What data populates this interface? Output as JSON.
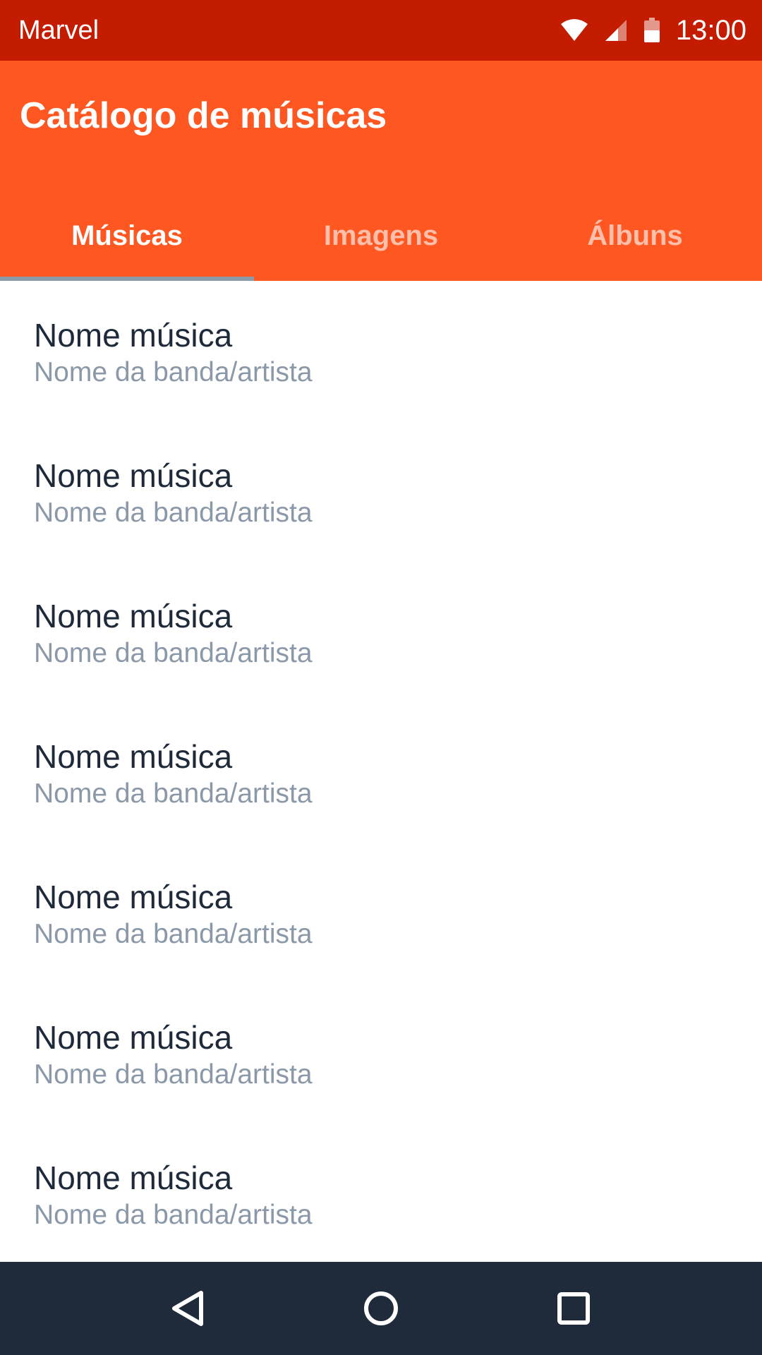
{
  "status_bar": {
    "carrier": "Marvel",
    "time": "13:00",
    "icons": [
      "wifi-icon",
      "signal-icon",
      "battery-icon"
    ]
  },
  "app_bar": {
    "title": "Catálogo de músicas",
    "background_color": "#ff5722"
  },
  "tabs": [
    {
      "label": "Músicas",
      "active": true
    },
    {
      "label": "Imagens",
      "active": false
    },
    {
      "label": "Álbuns",
      "active": false
    }
  ],
  "songs": [
    {
      "title": "Nome música",
      "artist": "Nome da banda/artista"
    },
    {
      "title": "Nome música",
      "artist": "Nome da banda/artista"
    },
    {
      "title": "Nome música",
      "artist": "Nome da banda/artista"
    },
    {
      "title": "Nome música",
      "artist": "Nome da banda/artista"
    },
    {
      "title": "Nome música",
      "artist": "Nome da banda/artista"
    },
    {
      "title": "Nome música",
      "artist": "Nome da banda/artista"
    },
    {
      "title": "Nome música",
      "artist": "Nome da banda/artista"
    }
  ],
  "nav_bar": {
    "buttons": [
      "back-icon",
      "home-icon",
      "recents-icon"
    ]
  },
  "colors": {
    "status_bar": "#c31c00",
    "accent": "#ff5722",
    "nav_bar": "#1f2b3b"
  }
}
